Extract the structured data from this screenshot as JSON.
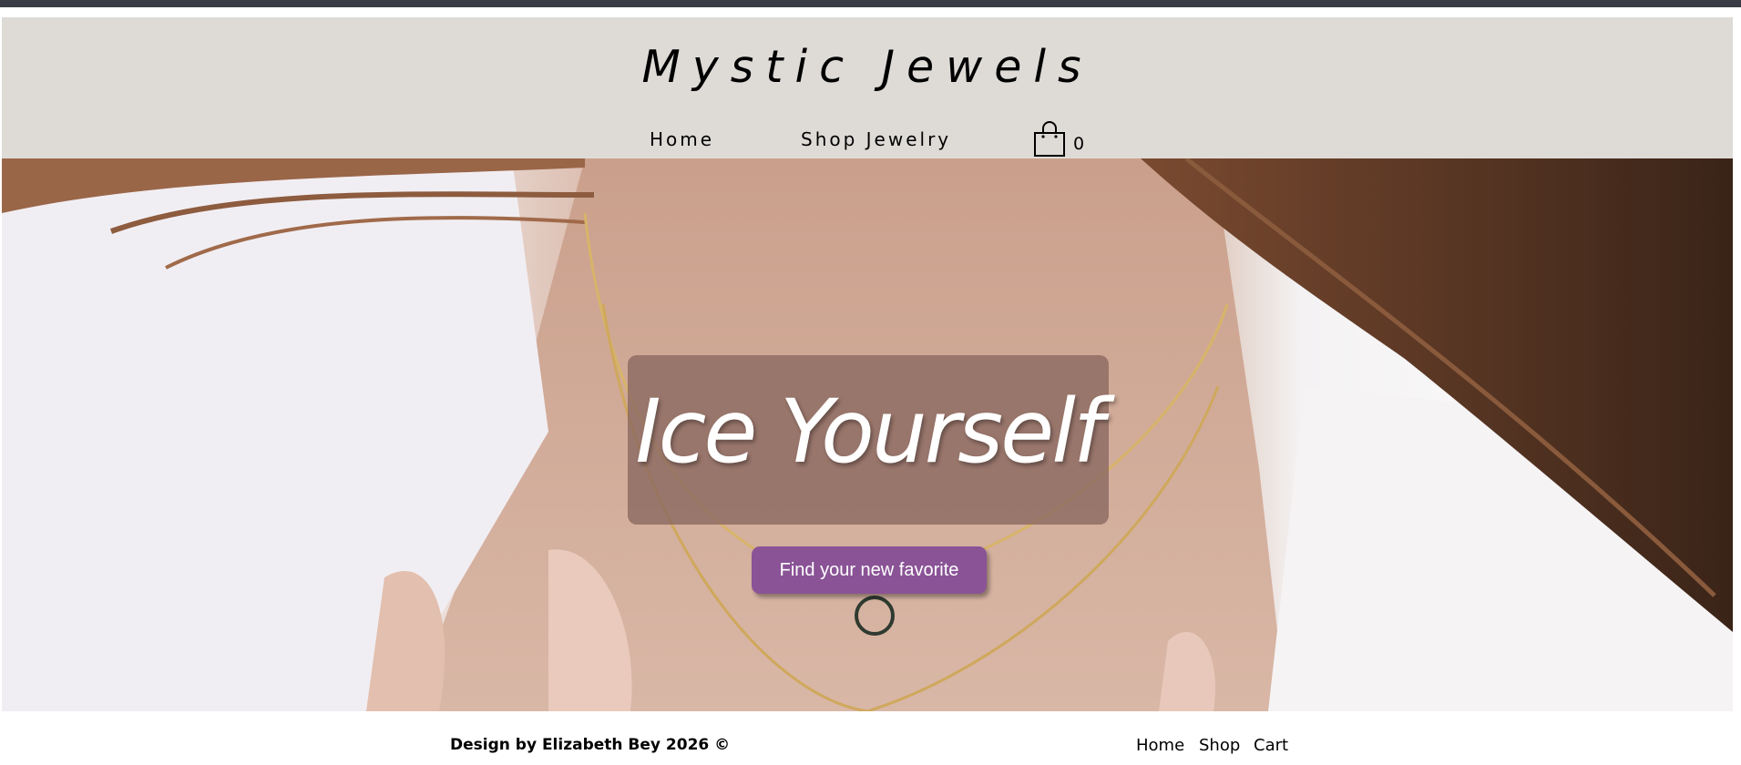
{
  "header": {
    "brand": "Mystic Jewels",
    "nav": {
      "home": "Home",
      "shop": "Shop Jewelry"
    },
    "cart": {
      "icon": "shopping-bag-icon",
      "count": "0"
    }
  },
  "hero": {
    "headline": "Ice Yourself",
    "cta": "Find your new favorite",
    "colors": {
      "overlay": "#8c6a62",
      "button": "#8a5396"
    }
  },
  "footer": {
    "credit": "Design by Elizabeth Bey 2026 ©",
    "links": [
      "Home",
      "Shop",
      "Cart"
    ]
  },
  "colors": {
    "header_bg": "#dedbd7",
    "top_strip": "#3a3d45"
  }
}
